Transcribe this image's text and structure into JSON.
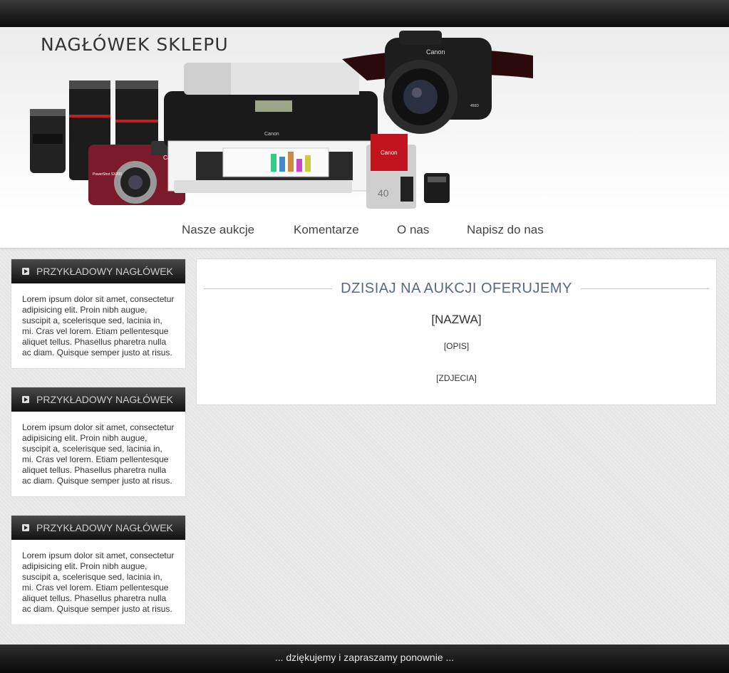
{
  "header": {
    "shop_title": "NAGŁÓWEK SKLEPU"
  },
  "nav": {
    "items": [
      {
        "label": "Nasze aukcje"
      },
      {
        "label": "Komentarze"
      },
      {
        "label": "O nas"
      },
      {
        "label": "Napisz do nas"
      }
    ]
  },
  "sidebar": {
    "boxes": [
      {
        "title": "PRZYKŁADOWY NAGŁÓWEK",
        "text": "Lorem ipsum dolor sit amet, consectetur adipisicing elit. Proin nibh augue, suscipit a, scelerisque sed, lacinia in, mi. Cras vel lorem. Etiam pellentesque aliquet tellus. Phasellus pharetra nulla ac diam. Quisque semper justo at risus."
      },
      {
        "title": "PRZYKŁADOWY NAGŁÓWEK",
        "text": "Lorem ipsum dolor sit amet, consectetur adipisicing elit. Proin nibh augue, suscipit a, scelerisque sed, lacinia in, mi. Cras vel lorem. Etiam pellentesque aliquet tellus. Phasellus pharetra nulla ac diam. Quisque semper justo at risus."
      },
      {
        "title": "PRZYKŁADOWY NAGŁÓWEK",
        "text": "Lorem ipsum dolor sit amet, consectetur adipisicing elit. Proin nibh augue, suscipit a, scelerisque sed, lacinia in, mi. Cras vel lorem. Etiam pellentesque aliquet tellus. Phasellus pharetra nulla ac diam. Quisque semper justo at risus."
      }
    ]
  },
  "main": {
    "heading": "DZISIAJ NA AUKCJI OFERUJEMY",
    "name": "[NAZWA]",
    "description": "[OPIS]",
    "photos": "[ZDJECIA]"
  },
  "banner": {
    "brand_label": "Canon",
    "camera_model": "PowerShot SX200",
    "dslr_model": "450D",
    "ink_number": "40"
  },
  "footer": {
    "text": "... dziękujemy i zapraszamy ponownie ..."
  },
  "colors": {
    "heading": "#5a6a7e",
    "dark_bar": "#111111"
  }
}
